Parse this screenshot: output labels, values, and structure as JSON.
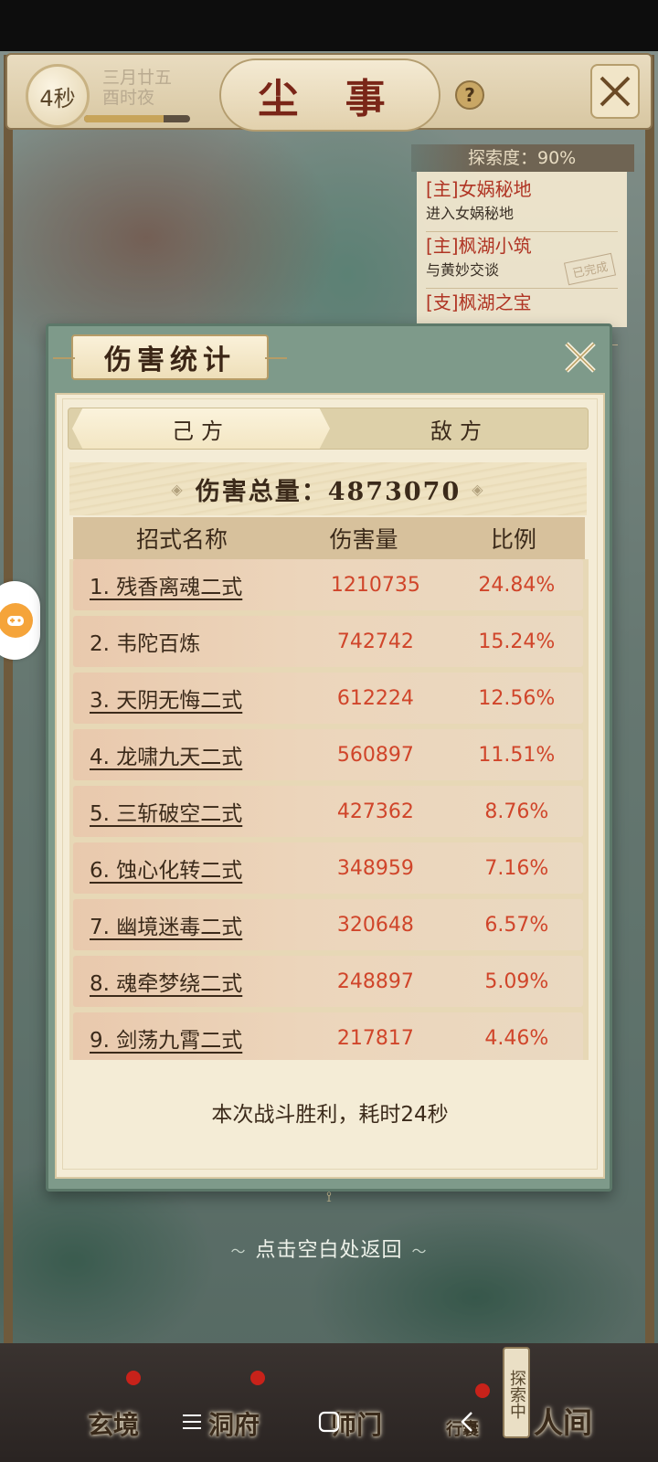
{
  "header": {
    "timer": "4秒",
    "date_line1": "三月廿五",
    "date_line2": "酉时夜",
    "title": "尘  事",
    "help": "?",
    "time_progress": 0.75
  },
  "quest": {
    "explore_label": "探索度：90%",
    "items": [
      {
        "title": "[主]女娲秘地",
        "desc": "进入女娲秘地",
        "stamp": ""
      },
      {
        "title": "[主]枫湖小筑",
        "desc": "与黄妙交谈",
        "stamp": "已完成"
      },
      {
        "title": "[支]枫湖之宝",
        "desc": "",
        "stamp": ""
      }
    ]
  },
  "modal": {
    "title": "伤害统计",
    "tabs": {
      "own": "己方",
      "enemy": "敌方"
    },
    "total_label": "伤害总量：4873070",
    "columns": {
      "name": "招式名称",
      "damage": "伤害量",
      "ratio": "比例"
    },
    "rows": [
      {
        "name": "1. 残香离魂二式",
        "damage": "1210735",
        "ratio": "24.84%"
      },
      {
        "name": "2. 韦陀百炼",
        "damage": "742742",
        "ratio": "15.24%"
      },
      {
        "name": "3. 天阴无悔二式",
        "damage": "612224",
        "ratio": "12.56%"
      },
      {
        "name": "4. 龙啸九天二式",
        "damage": "560897",
        "ratio": "11.51%"
      },
      {
        "name": "5. 三斩破空二式",
        "damage": "427362",
        "ratio": "8.76%"
      },
      {
        "name": "6. 蚀心化转二式",
        "damage": "348959",
        "ratio": "7.16%"
      },
      {
        "name": "7. 幽境迷毒二式",
        "damage": "320648",
        "ratio": "6.57%"
      },
      {
        "name": "8. 魂牵梦绕二式",
        "damage": "248897",
        "ratio": "5.09%"
      },
      {
        "name": "9. 剑荡九霄二式",
        "damage": "217817",
        "ratio": "4.46%"
      }
    ],
    "result": "本次战斗胜利，耗时24秒"
  },
  "back_hint": "点击空白处返回",
  "bottom_nav": {
    "items": [
      "玄境",
      "洞府",
      "师门",
      "行囊",
      "人间"
    ],
    "explore_badge": "探索中"
  },
  "colors": {
    "accent_red": "#d0452a",
    "title_red": "#7a2618",
    "paper": "#f4ecd6"
  }
}
